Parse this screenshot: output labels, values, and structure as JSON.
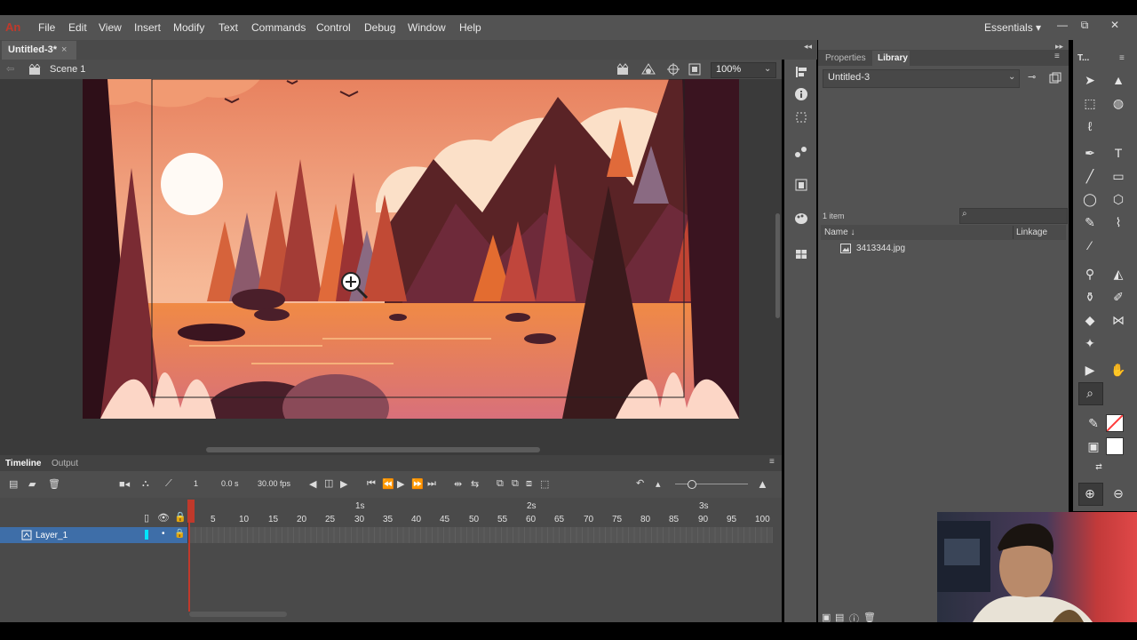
{
  "app": {
    "logo": "An"
  },
  "menubar": {
    "items": [
      "File",
      "Edit",
      "View",
      "Insert",
      "Modify",
      "Text",
      "Commands",
      "Control",
      "Debug",
      "Window",
      "Help"
    ],
    "workspace": "Essentials",
    "workspace_chevron": "▾",
    "window_controls": [
      "—",
      "⧉",
      "✕"
    ]
  },
  "document": {
    "tab_title": "Untitled-3*",
    "close": "×"
  },
  "editbar": {
    "scene": "Scene 1",
    "zoom": "100%"
  },
  "properties_panel": {
    "tabs": [
      "Properties",
      "Library"
    ],
    "active_tab": "Library"
  },
  "library": {
    "document": "Untitled-3",
    "item_count": "1 item",
    "columns": {
      "name": "Name ↓",
      "linkage": "Linkage"
    },
    "items": [
      {
        "name": "3413344.jpg",
        "icon": "image-icon"
      }
    ]
  },
  "tools_panel": {
    "title": "T..."
  },
  "timeline": {
    "tabs": [
      "Timeline",
      "Output"
    ],
    "active_tab": "Timeline",
    "current_frame": "1",
    "time": "0.0 s",
    "fps": "30.00 fps",
    "seconds_marks": [
      "1s",
      "2s",
      "3s"
    ],
    "frame_numbers": [
      "1",
      "5",
      "10",
      "15",
      "20",
      "25",
      "30",
      "35",
      "40",
      "45",
      "50",
      "55",
      "60",
      "65",
      "70",
      "75",
      "80",
      "85",
      "90",
      "95",
      "100"
    ],
    "layers": [
      {
        "name": "Layer_1",
        "color": "#00e5ff",
        "selected": true
      }
    ]
  },
  "colors": {
    "accent": "#3e6ea8",
    "playhead": "#c0392b",
    "stroke_swatch": "#ff3b3b",
    "fill_swatch": "#ffffff"
  }
}
